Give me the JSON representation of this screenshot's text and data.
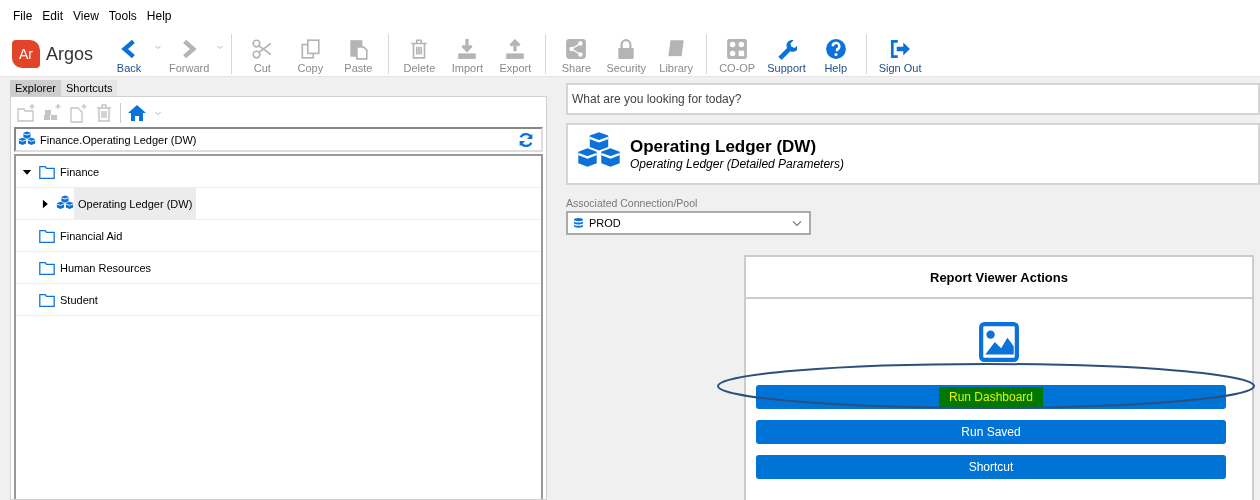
{
  "menu": [
    "File",
    "Edit",
    "View",
    "Tools",
    "Help"
  ],
  "logo": {
    "badge": "Ar",
    "name": "Argos"
  },
  "toolbar": [
    [
      {
        "label": "Back",
        "kind": "back",
        "disabled": false,
        "has_menu": true
      },
      {
        "label": "Forward",
        "kind": "forward",
        "disabled": true,
        "has_menu": true
      }
    ],
    [
      {
        "label": "Cut",
        "kind": "cut",
        "disabled": true,
        "has_menu": false
      },
      {
        "label": "Copy",
        "kind": "copy",
        "disabled": true,
        "has_menu": false
      },
      {
        "label": "Paste",
        "kind": "paste",
        "disabled": true,
        "has_menu": false
      }
    ],
    [
      {
        "label": "Delete",
        "kind": "trash",
        "disabled": true,
        "has_menu": false
      },
      {
        "label": "Import",
        "kind": "import",
        "disabled": true,
        "has_menu": false
      },
      {
        "label": "Export",
        "kind": "export",
        "disabled": true,
        "has_menu": false
      }
    ],
    [
      {
        "label": "Share",
        "kind": "share",
        "disabled": true,
        "has_menu": false
      },
      {
        "label": "Security",
        "kind": "lock",
        "disabled": true,
        "has_menu": false
      },
      {
        "label": "Library",
        "kind": "book",
        "disabled": true,
        "has_menu": false
      }
    ],
    [
      {
        "label": "CO-OP",
        "kind": "coop",
        "disabled": true,
        "has_menu": false
      },
      {
        "label": "Support",
        "kind": "wrench",
        "disabled": false,
        "has_menu": false
      },
      {
        "label": "Help",
        "kind": "help",
        "disabled": false,
        "has_menu": false
      }
    ],
    [
      {
        "label": "Sign Out",
        "kind": "signout",
        "disabled": false,
        "has_menu": false
      }
    ]
  ],
  "explorer": {
    "tabs": [
      {
        "label": "Explorer",
        "selected": true
      },
      {
        "label": "Shortcuts",
        "selected": false
      }
    ],
    "tools": [
      {
        "kind": "folder-plus",
        "disabled": true
      },
      {
        "kind": "cubes-plus",
        "disabled": true
      },
      {
        "kind": "file-plus",
        "disabled": true
      },
      {
        "kind": "trash",
        "disabled": true
      },
      {
        "kind": "home",
        "disabled": false
      }
    ],
    "path": "Finance.Operating Ledger (DW)",
    "tree": [
      {
        "label": "Finance",
        "kind": "folder",
        "expanded": true,
        "selected": false,
        "children": [
          {
            "label": "Operating Ledger (DW)",
            "kind": "report",
            "expanded": false,
            "selected": true
          }
        ]
      },
      {
        "label": "Financial Aid",
        "kind": "folder",
        "selected": false
      },
      {
        "label": "Human Resources",
        "kind": "folder",
        "selected": false
      },
      {
        "label": "Student",
        "kind": "folder",
        "selected": false
      }
    ]
  },
  "search": {
    "placeholder": "What are you looking for today?"
  },
  "report": {
    "title": "Operating Ledger (DW)",
    "subtitle": "Operating Ledger (Detailed Parameters)"
  },
  "connection": {
    "label": "Associated Connection/Pool",
    "value": "PROD"
  },
  "actions": {
    "title": "Report Viewer Actions",
    "buttons": [
      {
        "label": "Run Dashboard",
        "highlighted": true,
        "circled": true
      },
      {
        "label": "Run Saved",
        "highlighted": false,
        "circled": false
      },
      {
        "label": "Shortcut",
        "highlighted": false,
        "circled": false
      }
    ]
  }
}
